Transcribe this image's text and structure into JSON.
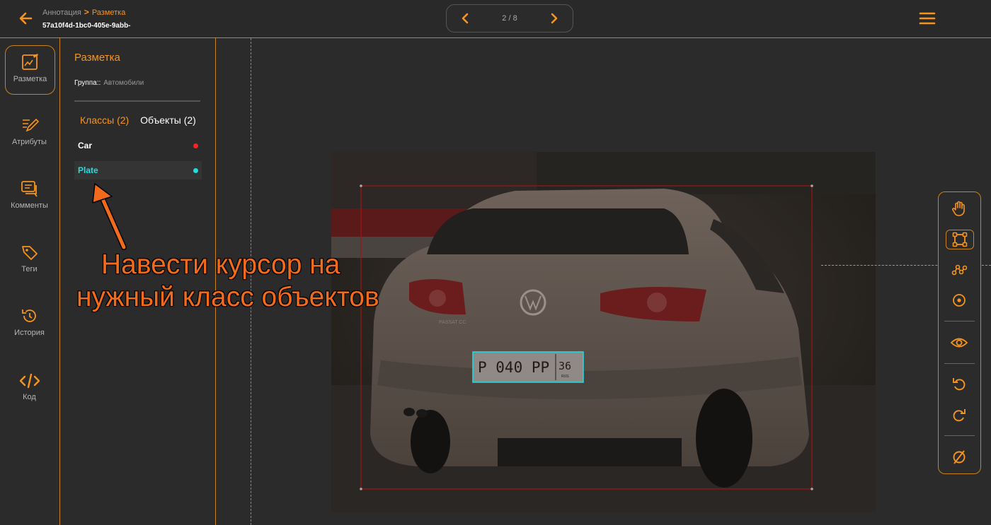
{
  "header": {
    "breadcrumb": {
      "parent": "Аннотация",
      "current": "Разметка"
    },
    "doc_id": "57a10f4d-1bc0-405e-9abb-",
    "pager": {
      "text": "2 / 8"
    }
  },
  "nav": [
    {
      "label": "Разметка",
      "icon": "edit-chart-icon",
      "active": true
    },
    {
      "label": "Атрибуты",
      "icon": "pen-lines-icon"
    },
    {
      "label": "Комменты",
      "icon": "comments-icon"
    },
    {
      "label": "Теги",
      "icon": "tag-icon"
    },
    {
      "label": "История",
      "icon": "history-icon"
    },
    {
      "label": "Код",
      "icon": "code-icon"
    }
  ],
  "panel": {
    "title": "Разметка",
    "group_key": "Группа::",
    "group_value": "Автомобили",
    "tabs": {
      "classes": "Классы (2)",
      "objects": "Объекты (2)"
    },
    "classes": [
      {
        "name": "Car",
        "color": "#ff2020",
        "text_color": "#ffffff"
      },
      {
        "name": "Plate",
        "color": "#18e0e6",
        "text_color": "#18e0e6"
      }
    ]
  },
  "image": {
    "plate_text": "P 040 PP",
    "plate_region": "36",
    "plate_country": "RUS",
    "car_model": "PASSAT CC"
  },
  "annotation": {
    "line1": "Навести курсор на",
    "line2": "нужный класс объектов"
  },
  "colors": {
    "accent": "#f7941d",
    "car_box": "#a01414",
    "plate_box": "#18e0e6"
  }
}
